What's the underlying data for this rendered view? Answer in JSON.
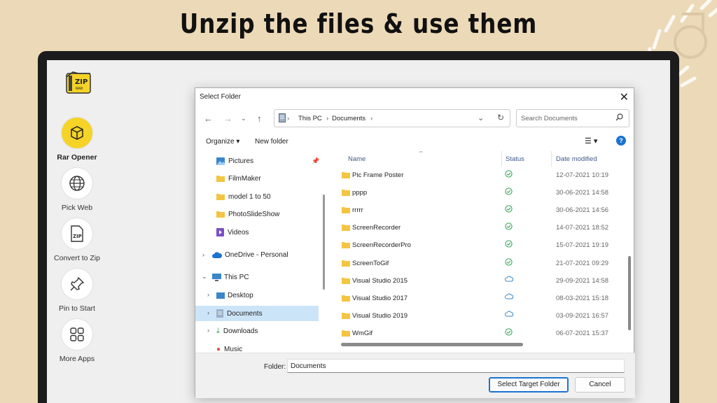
{
  "banner": {
    "title": "Unzip the files & use them"
  },
  "app": {
    "logo_text": "ZIP",
    "sidebar": [
      {
        "label": "Rar Opener",
        "icon": "package-icon",
        "active": true
      },
      {
        "label": "Pick Web",
        "icon": "globe-icon",
        "active": false
      },
      {
        "label": "Convert to Zip",
        "icon": "zip-file-icon",
        "active": false
      },
      {
        "label": "Pin to Start",
        "icon": "pin-icon",
        "active": false
      },
      {
        "label": "More Apps",
        "icon": "apps-grid-icon",
        "active": false
      }
    ]
  },
  "dialog": {
    "title": "Select Folder",
    "address": {
      "root": "This PC",
      "current": "Documents"
    },
    "search_placeholder": "Search Documents",
    "commands": {
      "organize": "Organize",
      "new_folder": "New folder"
    },
    "tree": [
      {
        "label": "Pictures",
        "icon": "pictures-icon"
      },
      {
        "label": "FilmMaker",
        "icon": "folder-icon"
      },
      {
        "label": "model 1 to 50",
        "icon": "folder-icon"
      },
      {
        "label": "PhotoSlideShow",
        "icon": "folder-icon"
      },
      {
        "label": "Videos",
        "icon": "videos-icon"
      },
      {
        "label": "OneDrive - Personal",
        "icon": "cloud-icon"
      },
      {
        "label": "This PC",
        "icon": "pc-icon"
      },
      {
        "label": "Desktop",
        "icon": "desktop-icon"
      },
      {
        "label": "Documents",
        "icon": "documents-icon",
        "selected": true
      },
      {
        "label": "Downloads",
        "icon": "download-icon"
      },
      {
        "label": "Music",
        "icon": "music-icon"
      }
    ],
    "columns": {
      "name": "Name",
      "status": "Status",
      "date": "Date modified"
    },
    "files": [
      {
        "name": "Pic Frame Poster",
        "status": "synced",
        "date": "12-07-2021 10:19"
      },
      {
        "name": "pppp",
        "status": "synced",
        "date": "30-06-2021 14:58"
      },
      {
        "name": "rrrrr",
        "status": "synced",
        "date": "30-06-2021 14:56"
      },
      {
        "name": "ScreenRecorder",
        "status": "synced",
        "date": "14-07-2021 18:52"
      },
      {
        "name": "ScreenRecorderPro",
        "status": "synced",
        "date": "15-07-2021 19:19"
      },
      {
        "name": "ScreenToGif",
        "status": "synced",
        "date": "21-07-2021 09:29"
      },
      {
        "name": "Visual Studio 2015",
        "status": "cloud",
        "date": "29-09-2021 14:58"
      },
      {
        "name": "Visual Studio 2017",
        "status": "cloud",
        "date": "08-03-2021 15:18"
      },
      {
        "name": "Visual Studio 2019",
        "status": "cloud",
        "date": "03-09-2021 16:57"
      },
      {
        "name": "WmGif",
        "status": "synced",
        "date": "06-07-2021 15:37"
      }
    ],
    "folder_label": "Folder:",
    "folder_value": "Documents",
    "select_button": "Select Target Folder",
    "cancel_button": "Cancel"
  },
  "colors": {
    "accent_yellow": "#f5d327",
    "banner_bg": "#ecd9b7",
    "selection": "#cce4f7",
    "sync_green": "#2e9e4f",
    "cloud_blue": "#3a86c8"
  }
}
